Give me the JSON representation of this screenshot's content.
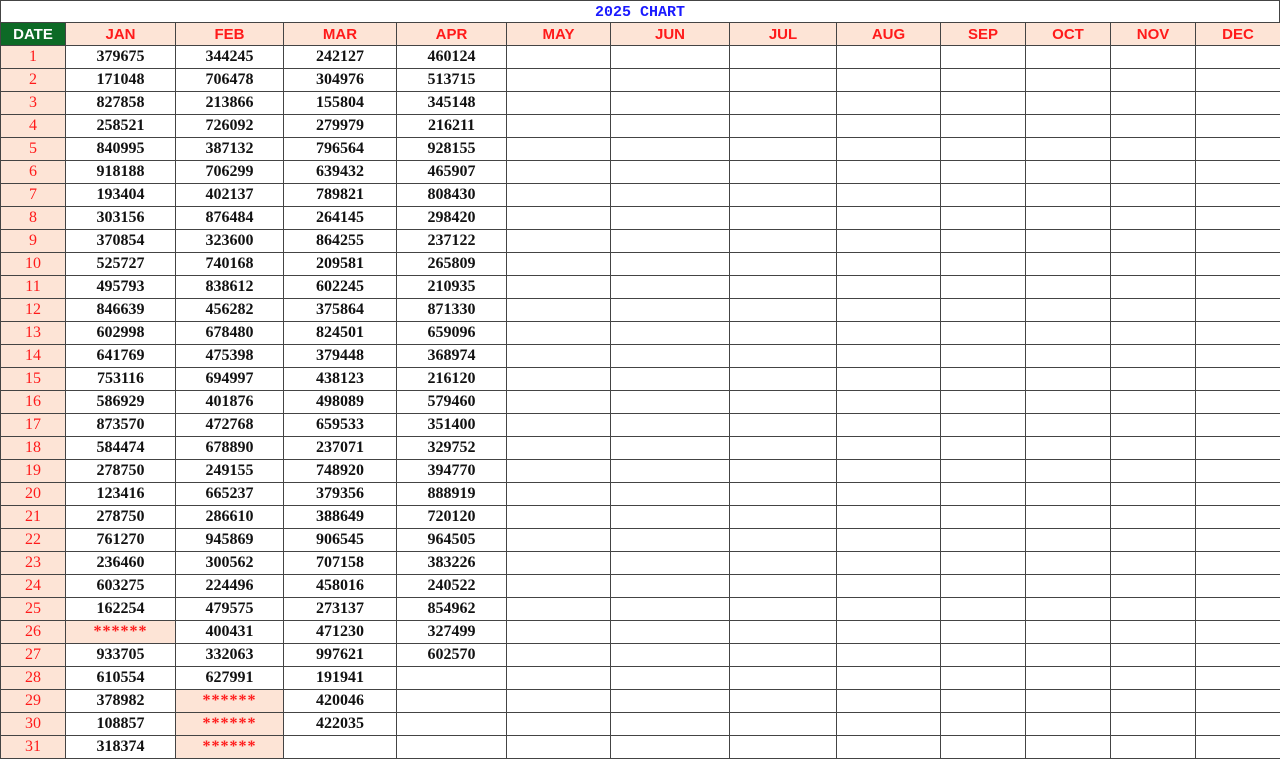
{
  "title": "2025 CHART",
  "colors": {
    "header_bg": "#fde4d6",
    "header_text": "#ff1a1a",
    "date_header_bg": "#0d6a26",
    "title_text": "#1a1aff"
  },
  "columns": [
    "DATE",
    "JAN",
    "FEB",
    "MAR",
    "APR",
    "MAY",
    "JUN",
    "JUL",
    "AUG",
    "SEP",
    "OCT",
    "NOV",
    "DEC"
  ],
  "rows": [
    [
      "1",
      "379675",
      "344245",
      "242127",
      "460124"
    ],
    [
      "2",
      "171048",
      "706478",
      "304976",
      "513715"
    ],
    [
      "3",
      "827858",
      "213866",
      "155804",
      "345148"
    ],
    [
      "4",
      "258521",
      "726092",
      "279979",
      "216211"
    ],
    [
      "5",
      "840995",
      "387132",
      "796564",
      "928155"
    ],
    [
      "6",
      "918188",
      "706299",
      "639432",
      "465907"
    ],
    [
      "7",
      "193404",
      "402137",
      "789821",
      "808430"
    ],
    [
      "8",
      "303156",
      "876484",
      "264145",
      "298420"
    ],
    [
      "9",
      "370854",
      "323600",
      "864255",
      "237122"
    ],
    [
      "10",
      "525727",
      "740168",
      "209581",
      "265809"
    ],
    [
      "11",
      "495793",
      "838612",
      "602245",
      "210935"
    ],
    [
      "12",
      "846639",
      "456282",
      "375864",
      "871330"
    ],
    [
      "13",
      "602998",
      "678480",
      "824501",
      "659096"
    ],
    [
      "14",
      "641769",
      "475398",
      "379448",
      "368974"
    ],
    [
      "15",
      "753116",
      "694997",
      "438123",
      "216120"
    ],
    [
      "16",
      "586929",
      "401876",
      "498089",
      "579460"
    ],
    [
      "17",
      "873570",
      "472768",
      "659533",
      "351400"
    ],
    [
      "18",
      "584474",
      "678890",
      "237071",
      "329752"
    ],
    [
      "19",
      "278750",
      "249155",
      "748920",
      "394770"
    ],
    [
      "20",
      "123416",
      "665237",
      "379356",
      "888919"
    ],
    [
      "21",
      "278750",
      "286610",
      "388649",
      "720120"
    ],
    [
      "22",
      "761270",
      "945869",
      "906545",
      "964505"
    ],
    [
      "23",
      "236460",
      "300562",
      "707158",
      "383226"
    ],
    [
      "24",
      "603275",
      "224496",
      "458016",
      "240522"
    ],
    [
      "25",
      "162254",
      "479575",
      "273137",
      "854962"
    ],
    [
      "26",
      "******",
      "400431",
      "471230",
      "327499"
    ],
    [
      "27",
      "933705",
      "332063",
      "997621",
      "602570"
    ],
    [
      "28",
      "610554",
      "627991",
      "191941",
      ""
    ],
    [
      "29",
      "378982",
      "******",
      "420046",
      ""
    ],
    [
      "30",
      "108857",
      "******",
      "422035",
      ""
    ],
    [
      "31",
      "318374",
      "******",
      "",
      ""
    ]
  ]
}
